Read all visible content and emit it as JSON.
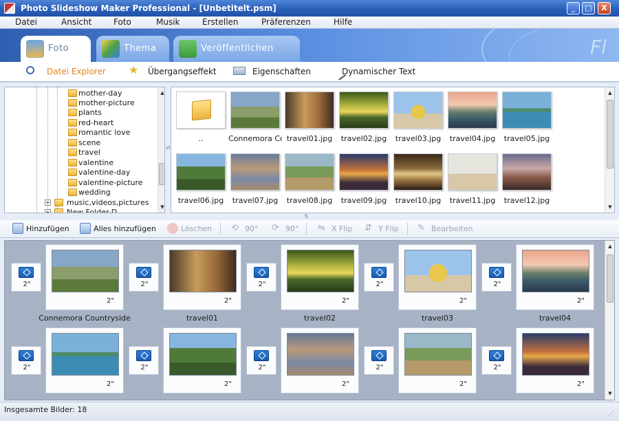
{
  "window": {
    "title": "Photo Slideshow Maker Professional - [Unbetitelt.psm]",
    "min_glyph": "_",
    "max_glyph": "□",
    "close_glyph": "X"
  },
  "menu": [
    "Datei",
    "Ansicht",
    "Foto",
    "Musik",
    "Erstellen",
    "Präferenzen",
    "Hilfe"
  ],
  "tabs": [
    {
      "label": "Foto",
      "active": true,
      "icon": "photo-icon"
    },
    {
      "label": "Thema",
      "active": false,
      "icon": "theme-icon"
    },
    {
      "label": "Veröffentlichen",
      "active": false,
      "icon": "publish-icon"
    }
  ],
  "subtabs": [
    {
      "label": "Datei Explorer",
      "active": true,
      "icon": "magnifier-icon"
    },
    {
      "label": "Übergangseffekt",
      "active": false,
      "icon": "transition-star-icon"
    },
    {
      "label": "Eigenschaften",
      "active": false,
      "icon": "properties-icon"
    },
    {
      "label": "Dynamischer Text",
      "active": false,
      "icon": "dynamic-text-icon"
    }
  ],
  "tree": {
    "folders": [
      "mother-day",
      "mother-picture",
      "plants",
      "red-heart",
      "romantic love",
      "scene",
      "travel",
      "valentine",
      "valentine-day",
      "valentine-picture",
      "wedding"
    ],
    "selected": "travel",
    "siblings": [
      "music,videos,pictures",
      "New Folder-D"
    ],
    "expander_glyph": "+"
  },
  "files": [
    {
      "name": "..",
      "thumb": "folder-up"
    },
    {
      "name": "Connemora Co...",
      "thumb": "countryside"
    },
    {
      "name": "travel01.jpg",
      "thumb": "t01"
    },
    {
      "name": "travel02.jpg",
      "thumb": "t02"
    },
    {
      "name": "travel03.jpg",
      "thumb": "t03"
    },
    {
      "name": "travel04.jpg",
      "thumb": "t04"
    },
    {
      "name": "travel05.jpg",
      "thumb": "t05"
    },
    {
      "name": "travel06.jpg",
      "thumb": "t06"
    },
    {
      "name": "travel07.jpg",
      "thumb": "t07"
    },
    {
      "name": "travel08.jpg",
      "thumb": "t08"
    },
    {
      "name": "travel09.jpg",
      "thumb": "t09"
    },
    {
      "name": "travel10.jpg",
      "thumb": "t10"
    },
    {
      "name": "travel11.jpg",
      "thumb": "t11"
    },
    {
      "name": "travel12.jpg",
      "thumb": "t12"
    }
  ],
  "actions": [
    {
      "label": "Hinzufügen",
      "enabled": true,
      "icon": "add-icon"
    },
    {
      "label": "Alles hinzufügen",
      "enabled": true,
      "icon": "add-all-icon"
    },
    {
      "label": "Löschen",
      "enabled": false,
      "icon": "delete-icon"
    },
    {
      "label": "90°",
      "enabled": false,
      "icon": "rotate-left-icon"
    },
    {
      "label": "90°",
      "enabled": false,
      "icon": "rotate-right-icon"
    },
    {
      "label": "X Flip",
      "enabled": false,
      "icon": "flip-x-icon"
    },
    {
      "label": "Y Flip",
      "enabled": false,
      "icon": "flip-y-icon"
    },
    {
      "label": "Bearbeiten",
      "enabled": false,
      "icon": "edit-icon"
    }
  ],
  "storyboard": {
    "transition_duration": "2\"",
    "slides": [
      {
        "label": "Connemora Countryside",
        "duration": "2\"",
        "thumb": "countryside"
      },
      {
        "label": "travel01",
        "duration": "2\"",
        "thumb": "t01"
      },
      {
        "label": "travel02",
        "duration": "2\"",
        "thumb": "t02"
      },
      {
        "label": "travel03",
        "duration": "2\"",
        "thumb": "t03"
      },
      {
        "label": "travel04",
        "duration": "2\"",
        "thumb": "t04"
      },
      {
        "label": "",
        "duration": "2\"",
        "thumb": "t05"
      },
      {
        "label": "",
        "duration": "2\"",
        "thumb": "t06"
      },
      {
        "label": "",
        "duration": "2\"",
        "thumb": "t07"
      },
      {
        "label": "",
        "duration": "2\"",
        "thumb": "t08"
      },
      {
        "label": "",
        "duration": "2\"",
        "thumb": "t09"
      }
    ]
  },
  "status": {
    "text": "Insgesamte Bilder: 18"
  },
  "colors": {
    "accent": "#e8821a",
    "titlebar": "#2a5fb8",
    "storyboard_bg": "#a7b3c4"
  }
}
